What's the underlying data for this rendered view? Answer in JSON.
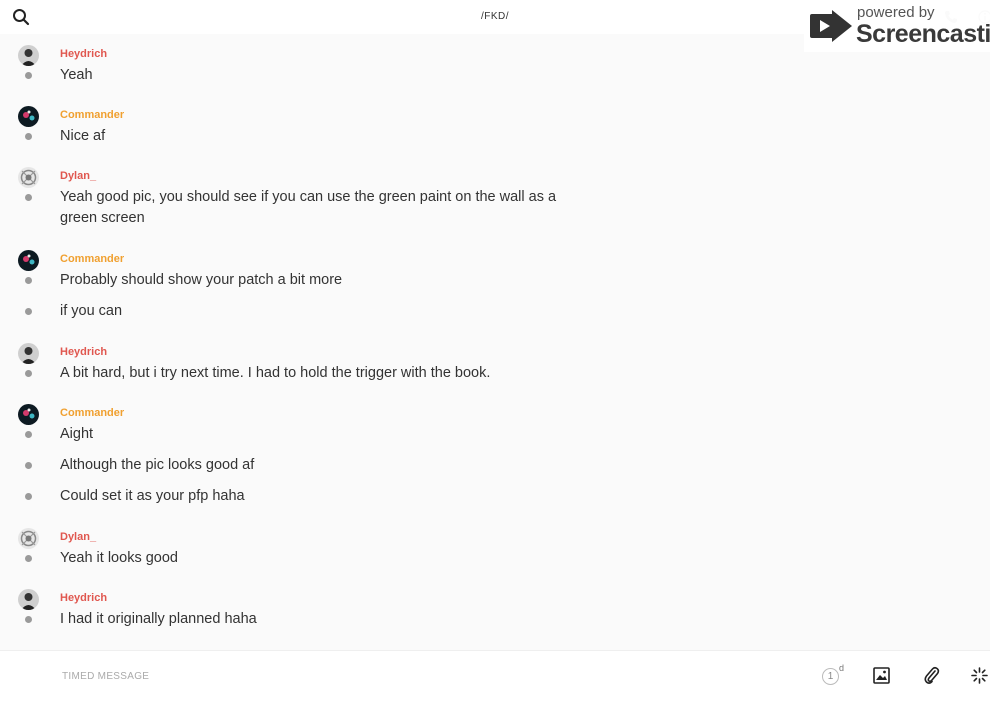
{
  "header": {
    "title": "/FKD/",
    "search_icon": "search-icon",
    "phone_icon": "phone-icon",
    "info_icon": "info-icon"
  },
  "watermark": {
    "powered": "powered by",
    "brand": "Screencastify"
  },
  "colors": {
    "heydrich": "#e0574f",
    "commander": "#f0a030",
    "dylan": "#e0574f"
  },
  "messages": [
    {
      "author": "Heydrich",
      "text": "Yeah"
    },
    {
      "author": "Commander",
      "text": "Nice af"
    },
    {
      "author": "Dylan_",
      "text": "Yeah good pic, you should see if you can use the green paint on the wall as a green screen"
    },
    {
      "author": "Commander",
      "text": "Probably should show your patch a bit more"
    },
    {
      "text": "if you can"
    },
    {
      "author": "Heydrich",
      "text": "A bit hard, but i try next time. I had to hold the trigger with the book."
    },
    {
      "author": "Commander",
      "text": "Aight"
    },
    {
      "text": "Although the pic looks good af"
    },
    {
      "text": "Could set it as your pfp haha"
    },
    {
      "author": "Dylan_",
      "text": "Yeah it looks good"
    },
    {
      "author": "Heydrich",
      "text": "I had it originally planned haha"
    }
  ],
  "composer": {
    "placeholder": "TIMED MESSAGE",
    "timer_value": "1",
    "timer_unit": "d"
  }
}
